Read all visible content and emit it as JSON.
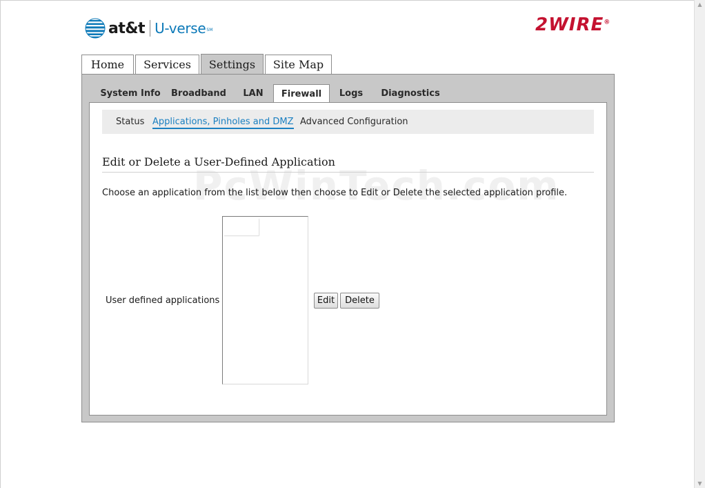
{
  "header": {
    "att_brand": "at&t",
    "uverse_brand": "U-verse",
    "uverse_tm": "SM",
    "partner_logo": "2WIRE"
  },
  "main_tabs": [
    {
      "label": "Home",
      "active": false
    },
    {
      "label": "Services",
      "active": false
    },
    {
      "label": "Settings",
      "active": true
    },
    {
      "label": "Site Map",
      "active": false
    }
  ],
  "sub_tabs": [
    {
      "label": "System Info",
      "active": false
    },
    {
      "label": "Broadband",
      "active": false
    },
    {
      "label": "LAN",
      "active": false
    },
    {
      "label": "Firewall",
      "active": true
    },
    {
      "label": "Logs",
      "active": false
    },
    {
      "label": "Diagnostics",
      "active": false
    }
  ],
  "firewall_nav": [
    {
      "label": "Status",
      "active": false
    },
    {
      "label": "Applications, Pinholes and DMZ",
      "active": true
    },
    {
      "label": "Advanced Configuration",
      "active": false
    }
  ],
  "content": {
    "section_title": "Edit or Delete a User-Defined Application",
    "instructions": "Choose an application from the list below then choose to Edit or Delete the selected application profile.",
    "field_label": "User defined applications",
    "edit_button": "Edit",
    "delete_button": "Delete"
  },
  "watermark": "PcWinTech.com",
  "colors": {
    "att_blue": "#0c79b8",
    "wire_red": "#c41230",
    "active_link": "#1a7fc1",
    "panel_grey": "#c8c8c8"
  }
}
